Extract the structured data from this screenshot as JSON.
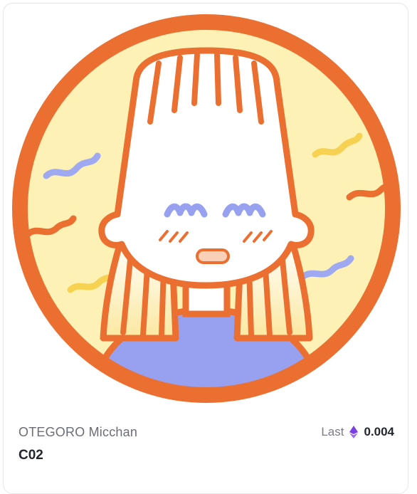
{
  "nft": {
    "image_icon": "avatar-illustration",
    "collection": "OTEGORO Micchan",
    "token_name": "C02"
  },
  "price": {
    "label": "Last",
    "currency_icon": "ethereum-icon",
    "value": "0.004"
  },
  "colors": {
    "ring": "#ec6f32",
    "background": "#fdf1b5",
    "shirt": "#97a1f0",
    "squiggle_blue": "#9ea9f2",
    "squiggle_yellow": "#f7d252",
    "eth": "#7b3fe4"
  }
}
